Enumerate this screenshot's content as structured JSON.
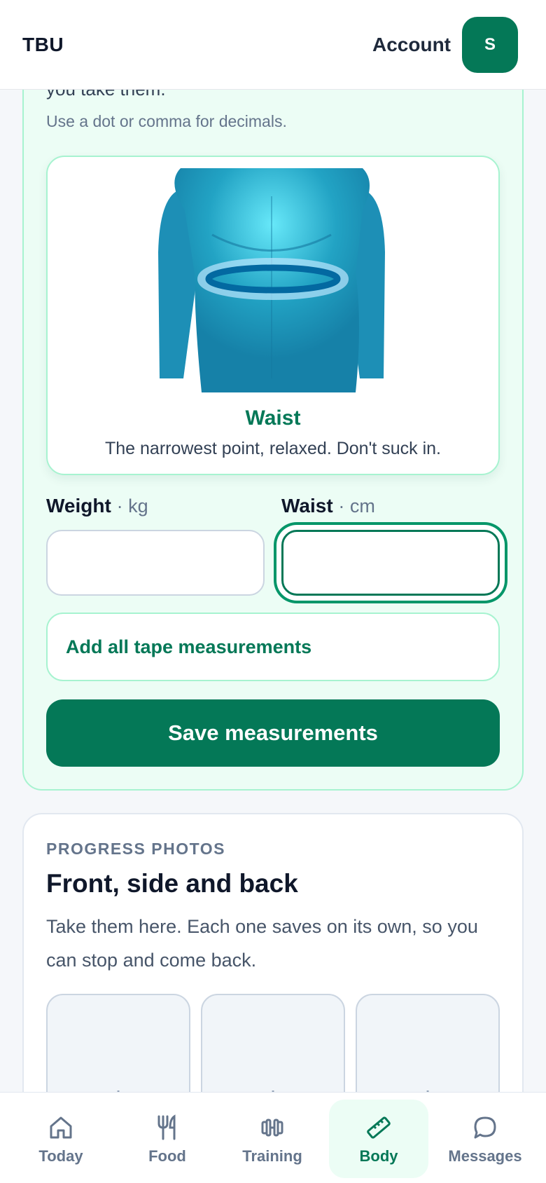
{
  "header": {
    "brand": "TBU",
    "account_label": "Account",
    "avatar_initial": "S"
  },
  "measure_card": {
    "cut_text": "you take them.",
    "hint": "Use a dot or comma for decimals.",
    "illustration": {
      "title": "Waist",
      "description": "The narrowest point, relaxed. Don't suck in."
    },
    "fields": {
      "weight": {
        "label": "Weight",
        "unit": "· kg",
        "value": "",
        "placeholder": ""
      },
      "waist": {
        "label": "Waist",
        "unit": "· cm",
        "value": "",
        "placeholder": ""
      }
    },
    "add_all_label": "Add all tape measurements",
    "save_label": "Save measurements"
  },
  "photos_card": {
    "eyebrow": "PROGRESS PHOTOS",
    "title": "Front, side and back",
    "description": "Take them here. Each one saves on its own, so you can stop and come back.",
    "slots": [
      "+",
      "+",
      "+"
    ]
  },
  "nav": {
    "items": [
      {
        "label": "Today",
        "icon": "home-icon"
      },
      {
        "label": "Food",
        "icon": "utensils-icon"
      },
      {
        "label": "Training",
        "icon": "dumbbell-icon"
      },
      {
        "label": "Body",
        "icon": "ruler-icon",
        "active": true
      },
      {
        "label": "Messages",
        "icon": "chat-bubble-icon"
      }
    ]
  },
  "colors": {
    "brand_green": "#047857",
    "mint_bg": "#ecfdf5",
    "mint_border": "#a7f3d0"
  }
}
